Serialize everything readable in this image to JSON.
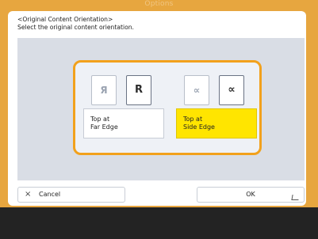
{
  "background": {
    "title": "Options"
  },
  "dialog": {
    "heading": "<Original Content Orientation>",
    "instruction": "Select the original content orientation.",
    "options": [
      {
        "icon_light": "Я",
        "icon_dark": "R",
        "line1": "Top at",
        "line2": "Far Edge",
        "selected": false
      },
      {
        "icon_light": "∝",
        "icon_dark": "∝",
        "line1": "Top at",
        "line2": "Side Edge",
        "selected": true
      }
    ],
    "cancel_label": "Cancel",
    "ok_label": "OK"
  },
  "colors": {
    "accent_orange": "#f2a11c",
    "selected_yellow": "#ffe500",
    "panel_blue_gray": "#d9dde5"
  },
  "icons": {
    "cancel": "close-icon",
    "ok": "enter-icon"
  }
}
